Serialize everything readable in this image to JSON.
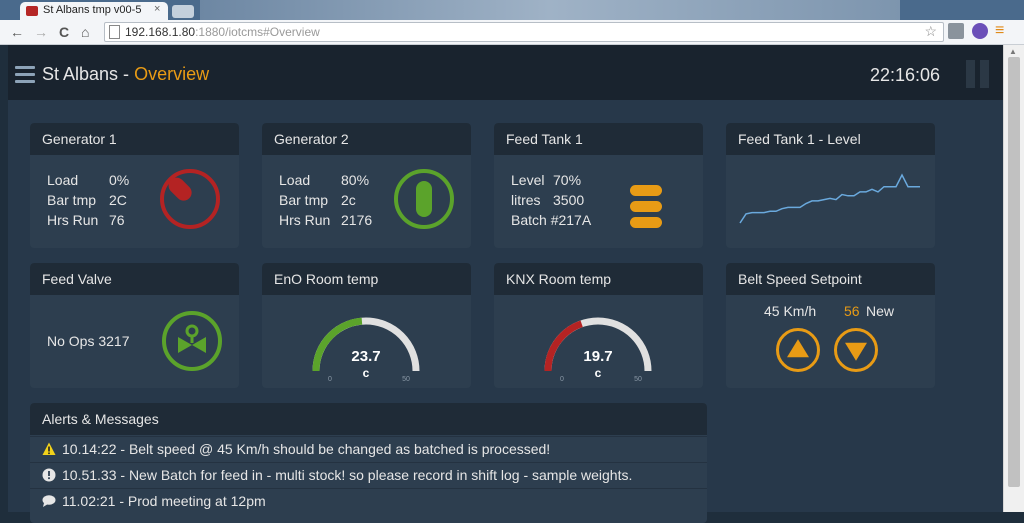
{
  "browser": {
    "tab_title": "St Albans tmp v00-5",
    "tab_close": "×",
    "url_host": "192.168.1.80",
    "url_rest": ":1880/iotcms#Overview",
    "back": "←",
    "forward": "→",
    "reload": "C",
    "home": "⌂",
    "star": "☆",
    "menu": "≡"
  },
  "header": {
    "site": "St Albans - ",
    "page": "Overview",
    "clock": "22:16:06"
  },
  "colors": {
    "accent": "#e89b15",
    "green": "#5ba32b",
    "red": "#b42323",
    "panel": "#2d3e4f"
  },
  "widgets": {
    "gen1": {
      "title": "Generator 1",
      "rows": [
        {
          "label": "Load",
          "value": "0%"
        },
        {
          "label": "Bar tmp",
          "value": "2C"
        },
        {
          "label": "Hrs Run",
          "value": "76"
        }
      ],
      "icon": "dial-off-icon"
    },
    "gen2": {
      "title": "Generator 2",
      "rows": [
        {
          "label": "Load",
          "value": "80%"
        },
        {
          "label": "Bar tmp",
          "value": "2c"
        },
        {
          "label": "Hrs Run",
          "value": "2176"
        }
      ],
      "icon": "dial-on-icon"
    },
    "tank1": {
      "title": "Feed Tank 1",
      "rows": [
        {
          "label": "Level",
          "value": "70%"
        },
        {
          "label": "litres",
          "value": "3500"
        },
        {
          "label": "Batch",
          "value": "#217A"
        }
      ],
      "icon": "tank-level-icon"
    },
    "tanklevel": {
      "title": "Feed Tank 1 - Level",
      "chart_data": {
        "type": "line",
        "values": [
          38,
          45,
          46,
          46,
          46,
          47,
          47,
          49,
          50,
          50,
          50,
          53,
          55,
          55,
          56,
          57,
          56,
          60,
          59,
          59,
          62,
          62,
          64,
          62,
          66,
          66,
          66,
          75,
          66,
          66,
          66
        ],
        "color": "#6aa9dd"
      }
    },
    "valve": {
      "title": "Feed Valve",
      "ops": "No Ops 3217",
      "icon": "valve-icon"
    },
    "eno": {
      "title": "EnO Room temp",
      "value": "23.7",
      "unit": "c",
      "min": "0",
      "max": "50",
      "fraction": 0.474,
      "color": "#5ba32b"
    },
    "knx": {
      "title": "KNX Room temp",
      "value": "19.7",
      "unit": "c",
      "min": "0",
      "max": "50",
      "fraction": 0.394,
      "color": "#b42323"
    },
    "belt": {
      "title": "Belt Speed Setpoint",
      "current": "45 Km/h",
      "new_value": "56",
      "new_label": "New"
    }
  },
  "alerts": {
    "title": "Alerts & Messages",
    "items": [
      {
        "icon": "warning-icon",
        "text": "10.14:22 - Belt speed @ 45 Km/h should be changed as batched is processed!"
      },
      {
        "icon": "info-icon",
        "text": "10.51.33 - New Batch for feed in - multi stock! so please record in shift log - sample weights."
      },
      {
        "icon": "chat-icon",
        "text": "11.02:21 - Prod meeting at 12pm"
      }
    ]
  }
}
